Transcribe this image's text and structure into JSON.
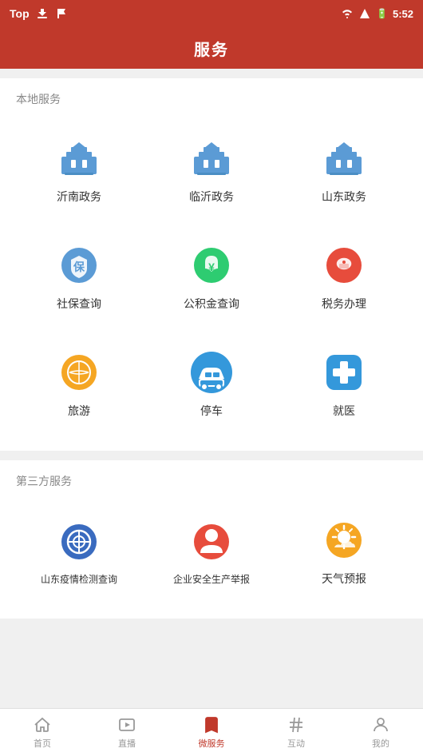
{
  "statusBar": {
    "leftText": "Top",
    "time": "5:52",
    "icons": {
      "wifi": "wifi-icon",
      "signal": "signal-icon",
      "battery": "battery-icon"
    }
  },
  "header": {
    "title": "服务"
  },
  "sections": [
    {
      "id": "local",
      "title": "本地服务",
      "items": [
        {
          "id": "linnan",
          "label": "沂南政务",
          "iconType": "bank",
          "color": "#5b9bd5"
        },
        {
          "id": "linyi",
          "label": "临沂政务",
          "iconType": "bank",
          "color": "#5b9bd5"
        },
        {
          "id": "shandong",
          "label": "山东政务",
          "iconType": "bank",
          "color": "#5b9bd5"
        },
        {
          "id": "shebao",
          "label": "社保查询",
          "iconType": "shield",
          "color": "#5b9bd5"
        },
        {
          "id": "gjj",
          "label": "公积金查询",
          "iconType": "housing",
          "color": "#2ecc71"
        },
        {
          "id": "tax",
          "label": "税务办理",
          "iconType": "tax",
          "color": "#e74c3c"
        },
        {
          "id": "travel",
          "label": "旅游",
          "iconType": "travel",
          "color": "#f39c12"
        },
        {
          "id": "parking",
          "label": "停车",
          "iconType": "parking",
          "color": "#3498db"
        },
        {
          "id": "medical",
          "label": "就医",
          "iconType": "medical",
          "color": "#3498db"
        }
      ]
    },
    {
      "id": "third-party",
      "title": "第三方服务",
      "items": [
        {
          "id": "epidemic",
          "label": "山东疫情检测查询",
          "iconType": "epidemic",
          "color": "#3a6bbf"
        },
        {
          "id": "safety",
          "label": "企业安全生产举报",
          "iconType": "safety",
          "color": "#e74c3c"
        },
        {
          "id": "weather",
          "label": "天气预报",
          "iconType": "weather",
          "color": "#f39c12"
        }
      ]
    }
  ],
  "bottomNav": {
    "items": [
      {
        "id": "home",
        "label": "首页",
        "icon": "home-icon",
        "active": false
      },
      {
        "id": "live",
        "label": "直播",
        "icon": "live-icon",
        "active": false
      },
      {
        "id": "microservice",
        "label": "微服务",
        "icon": "bookmark-icon",
        "active": true
      },
      {
        "id": "interact",
        "label": "互动",
        "icon": "hashtag-icon",
        "active": false
      },
      {
        "id": "mine",
        "label": "我的",
        "icon": "person-icon",
        "active": false
      }
    ]
  }
}
